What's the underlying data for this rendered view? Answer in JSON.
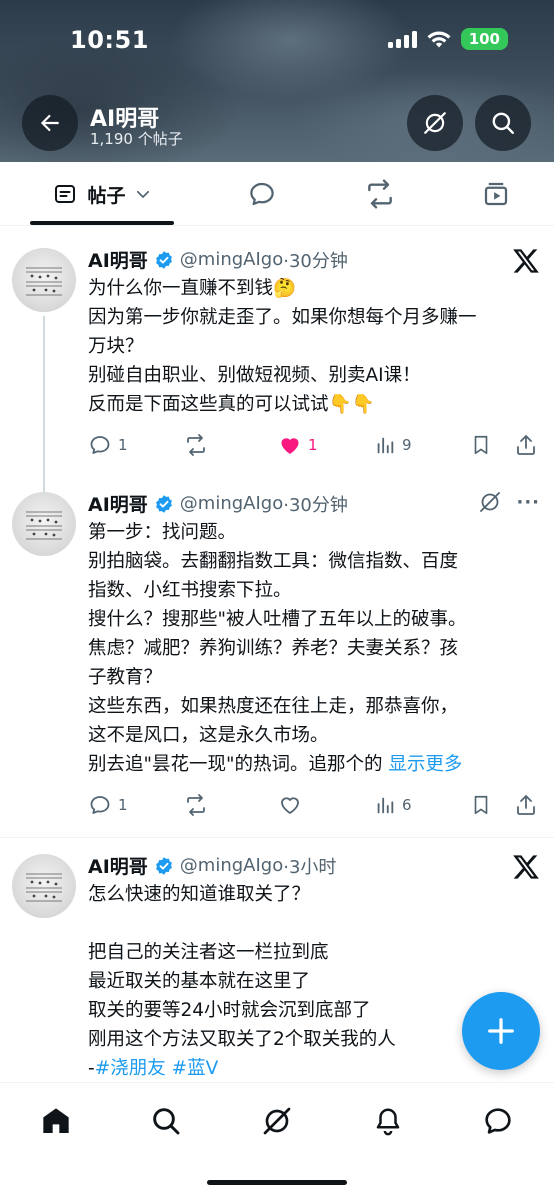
{
  "status_bar": {
    "time": "10:51",
    "battery": "100"
  },
  "header": {
    "title": "AI明哥",
    "subtitle": "1,190 个帖子"
  },
  "tabs": {
    "posts": "帖子"
  },
  "colors": {
    "accent": "#1d9bf0",
    "like": "#f91880",
    "battery": "#34c759",
    "text": "#0f1419",
    "secondary": "#536471"
  },
  "tweets": [
    {
      "name": "AI明哥",
      "handle": "@mingAIgo",
      "time": "·30分钟",
      "corner_icon": "x-logo-icon",
      "lines": [
        "为什么你一直赚不到钱🤔",
        "因为第一步你就走歪了。如果你想每个月多赚一",
        "万块？",
        "别碰自由职业、别做短视频、别卖AI课！",
        "反而是下面这些真的可以试试👇👇"
      ],
      "replies": "1",
      "likes": "1",
      "views": "9",
      "liked": true
    },
    {
      "name": "AI明哥",
      "handle": "@mingAIgo",
      "time": "·30分钟",
      "corner_icon": "grok-icon",
      "more": "···",
      "lines": [
        "第一步：找问题。",
        "别拍脑袋。去翻翻指数工具：微信指数、百度",
        "指数、小红书搜索下拉。",
        "搜什么？搜那些\"被人吐槽了五年以上的破事。",
        "焦虑？减肥？养狗训练？养老？夫妻关系？孩",
        "子教育？",
        "这些东西，如果热度还在往上走，那恭喜你，",
        "这不是风口，这是永久市场。"
      ],
      "last_line": "别去追\"昙花一现\"的热词。追那个的",
      "show_more": "显示更多",
      "replies": "1",
      "likes": "",
      "views": "6",
      "liked": false
    },
    {
      "name": "AI明哥",
      "handle": "@mingAIgo",
      "time": "·3小时",
      "corner_icon": "x-logo-icon",
      "lines_a": [
        "怎么快速的知道谁取关了？"
      ],
      "lines_b": [
        "把自己的关注者这一栏拉到底",
        "最近取关的基本就在这里了",
        "取关的要等24小时就会沉到底部了",
        "刚用这个方法又取关了2个取关我的人"
      ],
      "tag_prefix": "-",
      "tag1": "#浇朋友",
      "tag2": "#蓝V"
    }
  ],
  "bottom_nav": [
    "home-icon",
    "search-icon",
    "grok-icon",
    "bell-icon",
    "messages-icon"
  ]
}
